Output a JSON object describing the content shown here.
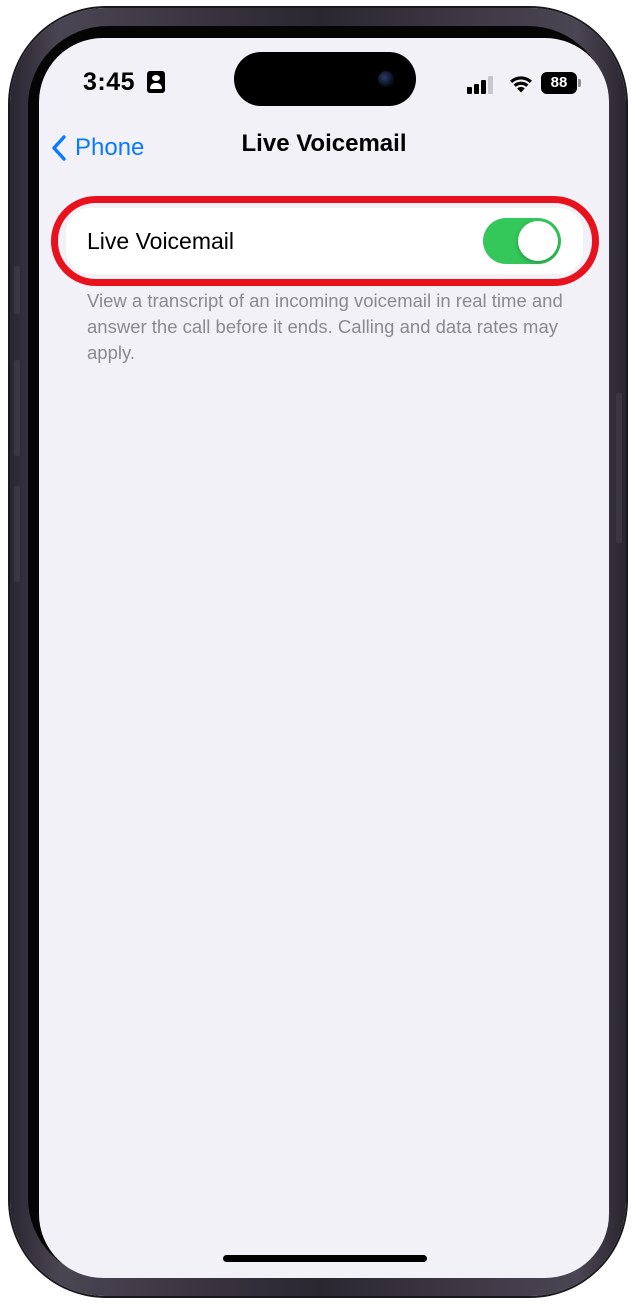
{
  "status_bar": {
    "time": "3:45",
    "battery_level": "88",
    "icons": [
      "contact-card-icon",
      "cellular-signal-icon",
      "wifi-icon",
      "battery-icon"
    ]
  },
  "nav": {
    "back_label": "Phone",
    "title": "Live Voicemail"
  },
  "settings": {
    "live_voicemail": {
      "label": "Live Voicemail",
      "enabled": true
    },
    "footer": "View a transcript of an incoming voicemail in real time and answer the call before it ends. Calling and data rates may apply."
  },
  "colors": {
    "accent": "#0a7aff",
    "toggle_on": "#34c759",
    "highlight": "#e8121c",
    "background": "#f2f1f7"
  }
}
